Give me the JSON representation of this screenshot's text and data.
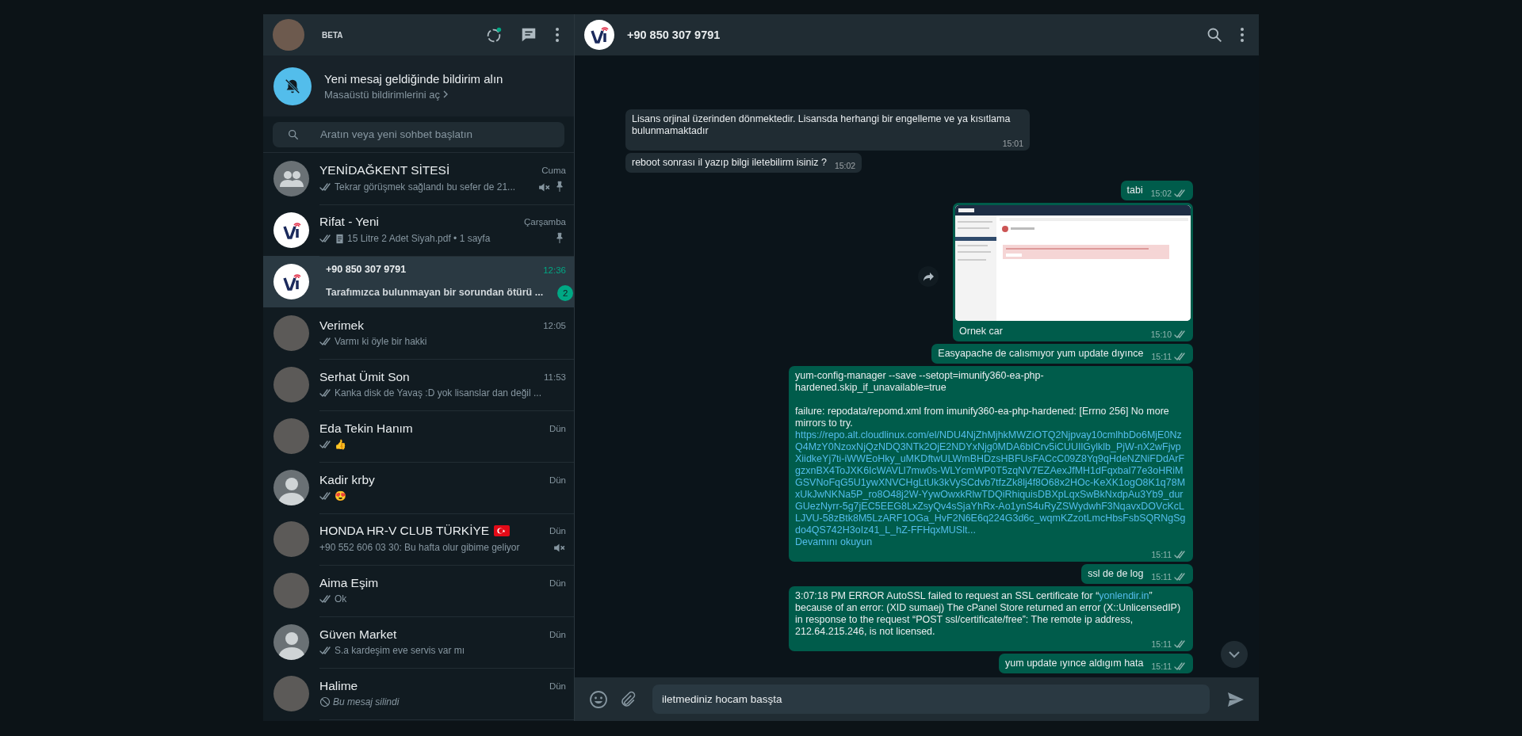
{
  "sidebar": {
    "header": {
      "label": "BETA"
    },
    "notice": {
      "title": "Yeni mesaj geldiğinde bildirim alın",
      "link": "Masaüstü bildirimlerini aç"
    },
    "search": {
      "placeholder": "Aratın veya yeni sohbet başlatın"
    },
    "chats": [
      {
        "name": "YENİDAĞKENT SİTESİ",
        "time": "Cuma",
        "avatar": {
          "kind": "group"
        },
        "flag": false,
        "ticks": true,
        "preview": {
          "kind": "text",
          "text": "Tekrar görüşmek sağlandı bu sefer de 21..."
        },
        "muted": true,
        "pinned": true,
        "selected": false
      },
      {
        "name": "Rifat - Yeni",
        "time": "Çarşamba",
        "avatar": {
          "kind": "logo"
        },
        "flag": false,
        "ticks": true,
        "preview": {
          "kind": "document",
          "text": "15 Litre 2 Adet Siyah.pdf • 1 sayfa"
        },
        "muted": false,
        "pinned": true,
        "selected": false
      },
      {
        "name": "+90 850 307 9791",
        "time": "12:36",
        "avatar": {
          "kind": "logo"
        },
        "flag": false,
        "ticks": false,
        "preview": {
          "kind": "text",
          "text": "Tarafımızca bulunmayan bir sorundan ötürü ..."
        },
        "muted": false,
        "pinned": false,
        "unread": "2",
        "selected": true
      },
      {
        "name": "Verimek",
        "time": "12:05",
        "avatar": {
          "kind": "photo"
        },
        "flag": false,
        "ticks": true,
        "preview": {
          "kind": "text",
          "text": "Varmı ki öyle bir hakki"
        },
        "muted": false,
        "pinned": false,
        "selected": false
      },
      {
        "name": "Serhat Ümit Son",
        "time": "11:53",
        "avatar": {
          "kind": "photo"
        },
        "flag": false,
        "ticks": true,
        "preview": {
          "kind": "text",
          "text": "Kanka disk de Yavaş :D yok lisanslar dan değil ..."
        },
        "muted": false,
        "pinned": false,
        "selected": false
      },
      {
        "name": "Eda Tekin Hanım",
        "time": "Dün",
        "avatar": {
          "kind": "photo"
        },
        "flag": false,
        "ticks": true,
        "preview": {
          "kind": "text",
          "text": "👍"
        },
        "muted": false,
        "pinned": false,
        "selected": false
      },
      {
        "name": "Kadir krby",
        "time": "Dün",
        "avatar": {
          "kind": "default"
        },
        "flag": false,
        "ticks": true,
        "preview": {
          "kind": "text",
          "text": "😍"
        },
        "muted": false,
        "pinned": false,
        "selected": false
      },
      {
        "name": "HONDA HR-V CLUB TÜRKİYE",
        "time": "Dün",
        "avatar": {
          "kind": "photo"
        },
        "flag": true,
        "ticks": false,
        "preview": {
          "kind": "text",
          "text": "+90 552 606 03 30: Bu hafta olur gibime geliyor"
        },
        "muted": true,
        "pinned": false,
        "selected": false
      },
      {
        "name": "Aima Eşim",
        "time": "Dün",
        "avatar": {
          "kind": "photo"
        },
        "flag": false,
        "ticks": true,
        "preview": {
          "kind": "text",
          "text": "Ok"
        },
        "muted": false,
        "pinned": false,
        "selected": false
      },
      {
        "name": "Güven Market",
        "time": "Dün",
        "avatar": {
          "kind": "default"
        },
        "flag": false,
        "ticks": true,
        "preview": {
          "kind": "text",
          "text": "S.a kardeşim eve servis var mı"
        },
        "muted": false,
        "pinned": false,
        "selected": false
      },
      {
        "name": "Halime",
        "time": "Dün",
        "avatar": {
          "kind": "photo"
        },
        "flag": false,
        "ticks": false,
        "preview": {
          "kind": "deleted",
          "text": "Bu mesaj silindi"
        },
        "muted": false,
        "pinned": false,
        "selected": false
      }
    ]
  },
  "conversation": {
    "title": "+90 850 307 9791",
    "avatar": {
      "kind": "logo"
    },
    "messages": [
      {
        "outgoing": false,
        "kind": "text",
        "text": "Lisans orjinal üzerinden dönmektedir. Lisansda herhangi bir engelleme ve ya kısıtlama bulunmamaktadır",
        "time": "15:01"
      },
      {
        "outgoing": false,
        "kind": "text",
        "text": "reboot sonrası il yazıp bilgi iletebilirm isiniz ?",
        "time": "15:02"
      },
      {
        "outgoing": true,
        "kind": "text",
        "text": "tabi",
        "time": "15:02"
      },
      {
        "outgoing": true,
        "kind": "image",
        "text": "Ornek car",
        "time": "15:10"
      },
      {
        "outgoing": true,
        "kind": "text",
        "text": "Easyapache de calısmıyor yum update dıyınce",
        "time": "15:11"
      },
      {
        "outgoing": true,
        "kind": "rich",
        "time": "15:11",
        "blocks": [
          {
            "kind": "text",
            "text": "yum-config-manager --save --setopt=imunify360-ea-php-hardened.skip_if_unavailable=true"
          },
          {
            "kind": "text",
            "text": "failure: repodata/repomd.xml from imunify360-ea-php-hardened: [Errno 256] No more mirrors to try."
          },
          {
            "kind": "url",
            "text": "https://repo.alt.cloudlinux.com/el/NDU4NjZhMjhkMWZiOTQ2Njpvay10cmlhbDo6MjE0NzQ4MzY0NzoxNjQzNDQ3NTk2OjE2NDYxNjg0MDA6bICrv5iCUUIlGylklb_PjW-nX2wFjvpXiidkeYj7ti-iWWEoHky_uMKDftwULWmBHDzsHBFUsFACcC09Z8Yq9qHdeNZNiFDdArFgzxnBX4ToJXK6IcWAVLl7mw0s-WLYcmWP0T5zqNV7EZAexJfMH1dFqxbal77e3oHRiMGSVNoFqG5U1ywXNVCHgLtUk3kVySCdvb7tfzZk8lj4f8O68x2HOc-KeXK1ogO8K1q78MxUkJwNKNa5P_ro8O48j2W-YywOwxkRlwTDQiRhiquisDBXpLqxSwBkNxdpAu3Yb9_durGUezNyrr-5g7jEC5EEG8LxZsyQv4sSjaYhRx-Ao1ynS4uRyZSWydwhF3NqavxDOVcKcLLJVU-58zBtk8M5LzARF1OGa_HvF2N6E6q224G3d6c_wqmKZzotLmcHbsFsbSQRNgSgdo4QS742H3oIz41_L_hZ-FFHqxMUSlt..."
          },
          {
            "kind": "more",
            "text": "Devamını okuyun"
          }
        ]
      },
      {
        "outgoing": true,
        "kind": "text",
        "text": "ssl de de log",
        "time": "15:11"
      },
      {
        "outgoing": true,
        "kind": "rich",
        "time": "15:11",
        "blocks": [
          {
            "kind": "paragraph",
            "segments": [
              {
                "kind": "text",
                "text": "3:07:18 PM ERROR AutoSSL failed to request an SSL certificate for “"
              },
              {
                "kind": "link",
                "text": "yonlendir.in"
              },
              {
                "kind": "text",
                "text": "” because of an error: (XID sumaej) The cPanel Store returned an error (X::UnlicensedIP) in response to the request “POST ssl/certificate/free”: The remote ip address, 212.64.215.246, is not licensed."
              }
            ]
          }
        ]
      },
      {
        "outgoing": true,
        "kind": "text",
        "text": "yum update ıyınce aldıgım hata",
        "time": "15:11"
      }
    ]
  },
  "composer": {
    "value": "iletmediniz hocam basşta"
  }
}
